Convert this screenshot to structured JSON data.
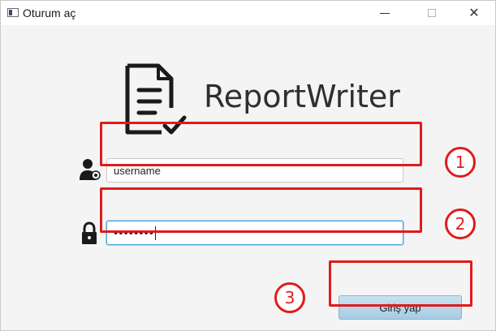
{
  "window": {
    "title": "Oturum aç",
    "minimize_icon": "minimize-icon",
    "maximize_icon": "maximize-icon",
    "close_icon": "close-icon",
    "close_glyph": "✕"
  },
  "app": {
    "name": "ReportWriter",
    "logo_icon": "document-check-icon"
  },
  "form": {
    "user_icon": "user-icon",
    "username_value": "username",
    "lock_icon": "lock-icon",
    "password_masked": "••••••••",
    "login_label": "Giriş yap"
  },
  "annotations": {
    "step_1": "1",
    "step_2": "2",
    "step_3": "3",
    "color": "#e01b1b"
  },
  "colors": {
    "button_fill": "#b7d8ec",
    "focus_border": "#4aa7d6",
    "background": "#f4f4f4"
  }
}
